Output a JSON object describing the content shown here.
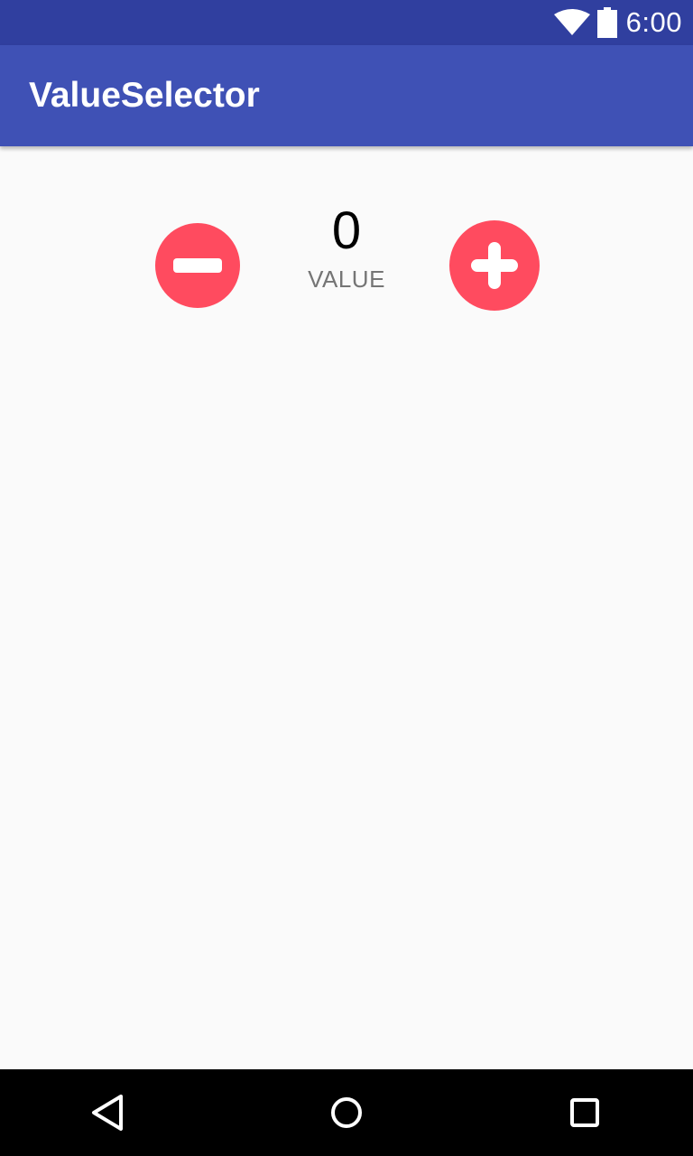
{
  "status_bar": {
    "time": "6:00",
    "icons": [
      "wifi-icon",
      "battery-icon"
    ],
    "background": "#303f9f"
  },
  "app_bar": {
    "title": "ValueSelector",
    "background": "#3f51b5"
  },
  "selector": {
    "value": "0",
    "label": "VALUE",
    "decrement_icon": "minus-circle-icon",
    "increment_icon": "plus-circle-icon",
    "accent": "#ff4b5f"
  },
  "nav_bar": {
    "icons": [
      "back-icon",
      "home-icon",
      "recents-icon"
    ],
    "background": "#000000"
  }
}
